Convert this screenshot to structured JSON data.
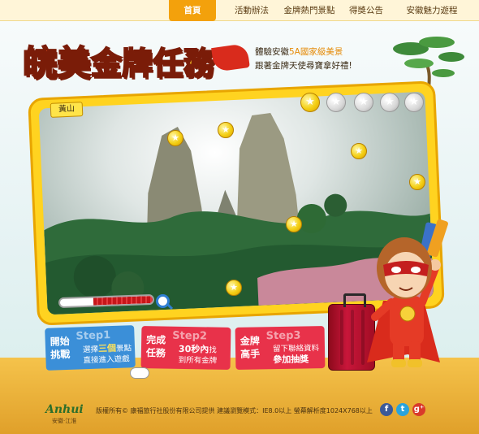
{
  "nav": {
    "items": [
      {
        "label": "首頁",
        "active": true
      },
      {
        "label": "活動辦法",
        "active": false
      },
      {
        "label": "金牌熱門景點",
        "active": false
      },
      {
        "label": "得獎公告",
        "active": false
      },
      {
        "label": "安徽魅力遊程",
        "active": false
      }
    ]
  },
  "header": {
    "title_part1": "皖美",
    "title_part2": "金牌任務",
    "tagline_line1_pre": "體驗安徽",
    "tagline_line1_hl": "5A國家級美景",
    "tagline_line2": "跟著金牌天使尋寶拿好禮!"
  },
  "game": {
    "location_label": "黃山",
    "medal_slots": [
      {
        "icon": "star-medal-icon",
        "collected": true
      },
      {
        "icon": "star-medal-icon",
        "collected": false
      },
      {
        "icon": "star-medal-icon",
        "collected": false
      },
      {
        "icon": "star-medal-icon",
        "collected": false
      },
      {
        "icon": "star-medal-icon",
        "collected": false
      }
    ],
    "coin_glyph": "★",
    "progress_fraction": 0.64
  },
  "steps": [
    {
      "big": "開始挑戰",
      "num": "Step1",
      "desc_pre": "選擇",
      "desc_hl": "三個",
      "desc_post": "景點",
      "desc_line2": "直接進入遊戲"
    },
    {
      "big": "完成任務",
      "num": "Step2",
      "desc_pre": "",
      "desc_hl": "30秒內",
      "desc_post": "找",
      "desc_line2": "到所有金牌"
    },
    {
      "big": "金牌高手",
      "num": "Step3",
      "desc_pre": "留下聯絡資料",
      "desc_hl": "",
      "desc_post": "",
      "desc_line2": "參加抽獎"
    }
  ],
  "footer": {
    "logo_text": "Anhui",
    "logo_sub": "安徽·江淮",
    "copyright": "版權所有© 康福旅行社股份有限公司提供 建議瀏覽模式：IE8.0以上 螢幕解析度1024X768以上",
    "social": [
      {
        "icon": "facebook-icon",
        "glyph": "f",
        "color": "#3b5998"
      },
      {
        "icon": "twitter-icon",
        "glyph": "t",
        "color": "#2aa3dc"
      },
      {
        "icon": "google-plus-icon",
        "glyph": "g⁺",
        "color": "#d93a2b"
      }
    ]
  }
}
